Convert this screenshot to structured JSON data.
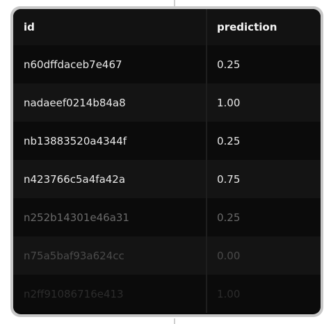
{
  "table": {
    "columns": [
      "id",
      "prediction"
    ],
    "rows": [
      {
        "id": "n60dffdaceb7e467",
        "prediction": "0.25"
      },
      {
        "id": "nadaeef0214b84a8",
        "prediction": "1.00"
      },
      {
        "id": "nb13883520a4344f",
        "prediction": "0.25"
      },
      {
        "id": "n423766c5a4fa42a",
        "prediction": "0.75"
      },
      {
        "id": "n252b14301e46a31",
        "prediction": "0.25"
      },
      {
        "id": "n75a5baf93a624cc",
        "prediction": "0.00"
      },
      {
        "id": "n2ff91086716e413",
        "prediction": "1.00"
      }
    ]
  }
}
